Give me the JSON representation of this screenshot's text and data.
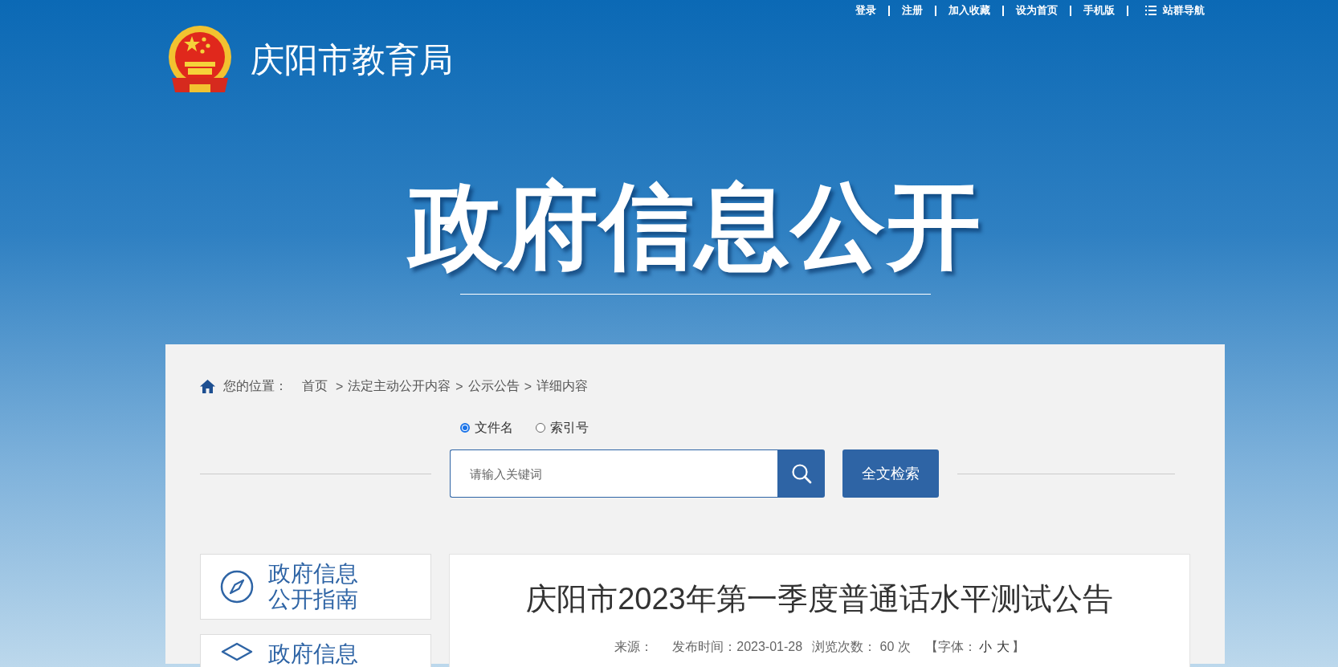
{
  "top_links": [
    {
      "label": "登录",
      "kind": "link"
    },
    {
      "label": "注册",
      "kind": "link"
    },
    {
      "label": "加入收藏",
      "kind": "link"
    },
    {
      "label": "设为首页",
      "kind": "link"
    },
    {
      "label": "手机版",
      "kind": "link"
    },
    {
      "label": "站群导航",
      "kind": "menu"
    }
  ],
  "site_title": "庆阳市教育局",
  "banner_title": "政府信息公开",
  "breadcrumb": {
    "label": "您的位置：",
    "separator": ">",
    "items": [
      "首页",
      "法定主动公开内容",
      "公示公告",
      "详细内容"
    ]
  },
  "search": {
    "options": [
      {
        "label": "文件名",
        "selected": true
      },
      {
        "label": "索引号",
        "selected": false
      }
    ],
    "placeholder": "请输入关键词",
    "fulltext_button": "全文检索"
  },
  "sidebar": [
    {
      "lines": [
        "政府信息",
        "公开指南"
      ],
      "kind": "compass"
    },
    {
      "lines": [
        "政府信息"
      ],
      "kind": "layers"
    }
  ],
  "article": {
    "title": "庆阳市2023年第一季度普通话水平测试公告",
    "source": "来源：",
    "date": "发布时间：2023-01-28",
    "views": "浏览次数：  60  次",
    "font_open": "【字体：",
    "font_sizes": [
      "小",
      "大"
    ],
    "font_close": "】"
  }
}
